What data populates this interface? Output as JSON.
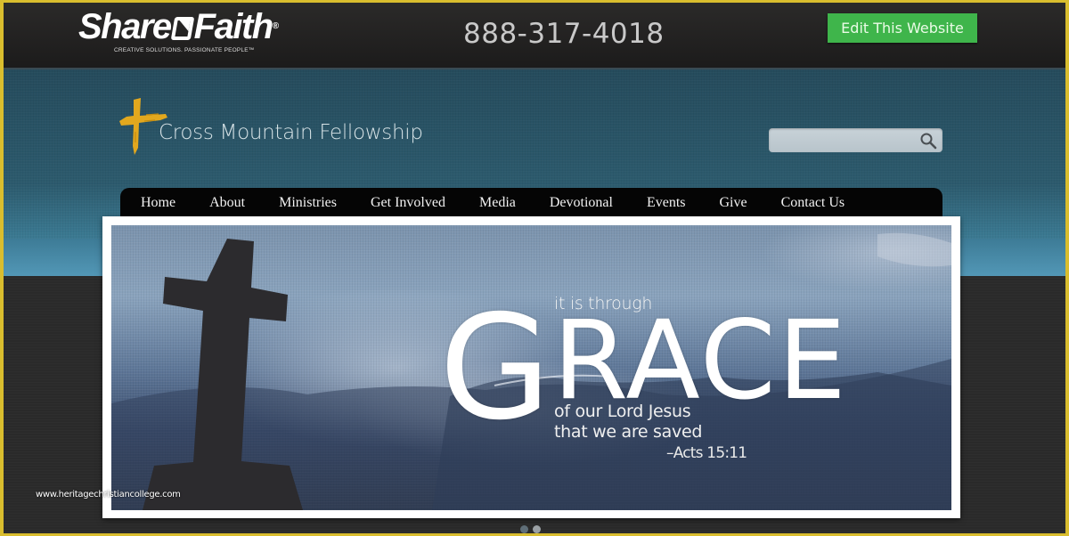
{
  "topbar": {
    "brand": {
      "name_part1": "Share",
      "name_part2": "Faith",
      "registered_mark": "®",
      "tagline": "CREATIVE SOLUTIONS. PASSIONATE PEOPLE™"
    },
    "phone": "888-317-4018",
    "edit_button_label": "Edit This Website",
    "edit_button_color": "#3fb54b"
  },
  "header": {
    "church_name": "Cross Mountain Fellowship",
    "logo_icon": "cross-icon",
    "logo_color": "#e2a81e",
    "search": {
      "value": "",
      "placeholder": "",
      "icon": "search-icon"
    }
  },
  "nav": {
    "items": [
      {
        "label": "Home"
      },
      {
        "label": "About"
      },
      {
        "label": "Ministries"
      },
      {
        "label": "Get Involved"
      },
      {
        "label": "Media"
      },
      {
        "label": "Devotional"
      },
      {
        "label": "Events"
      },
      {
        "label": "Give"
      },
      {
        "label": "Contact Us"
      }
    ]
  },
  "slider": {
    "slide": {
      "line_top": "it is through",
      "big_word_first": "G",
      "big_word_rest": "RACE",
      "line_2": "of our Lord Jesus",
      "line_3": "that we are saved",
      "reference": "–Acts 15:11"
    },
    "dots": [
      {
        "active": false,
        "color": "#5f6e78"
      },
      {
        "active": true,
        "color": "#9aa0a4"
      }
    ],
    "total_slides": 2
  },
  "watermark": "www.heritagechristiancollege.com"
}
